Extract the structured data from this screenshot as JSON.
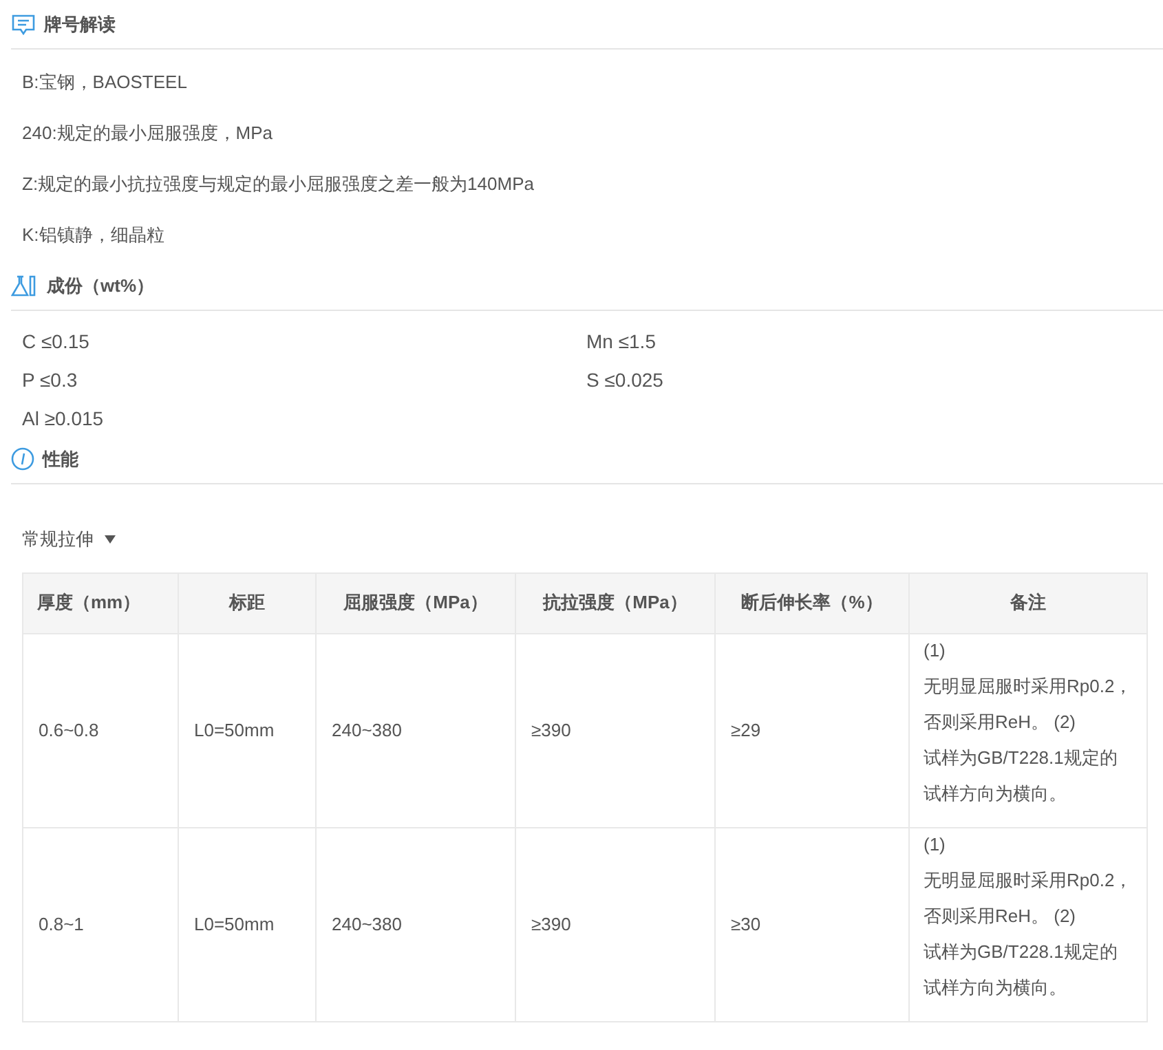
{
  "designation": {
    "title": "牌号解读",
    "items": [
      "B:宝钢，BAOSTEEL",
      "240:规定的最小屈服强度，MPa",
      "Z:规定的最小抗拉强度与规定的最小屈服强度之差一般为140MPa",
      "K:铝镇静，细晶粒"
    ]
  },
  "composition": {
    "title": "成份（wt%）",
    "items": [
      "C ≤0.15",
      "Mn ≤1.5",
      "P ≤0.3",
      "S ≤0.025",
      "Al ≥0.015"
    ]
  },
  "properties": {
    "title": "性能",
    "dropdown": "常规拉伸",
    "table": {
      "columns": [
        "厚度（mm）",
        "标距",
        "屈服强度（MPa）",
        "抗拉强度（MPa）",
        "断后伸长率（%）",
        "备注"
      ],
      "rows": [
        {
          "cells": [
            "0.6~0.8",
            "L0=50mm",
            "240~380",
            "≥390",
            "≥29"
          ],
          "note": [
            "(1)",
            "无明显屈服时采用Rp0.2，",
            "否则采用ReH。 (2)",
            "试样为GB/T228.1规定的",
            "试样方向为横向。"
          ]
        },
        {
          "cells": [
            "0.8~1",
            "L0=50mm",
            "240~380",
            "≥390",
            "≥30"
          ],
          "note": [
            "(1)",
            "无明显屈服时采用Rp0.2，",
            "否则采用ReH。 (2)",
            "试样为GB/T228.1规定的",
            "试样方向为横向。"
          ]
        }
      ]
    }
  }
}
